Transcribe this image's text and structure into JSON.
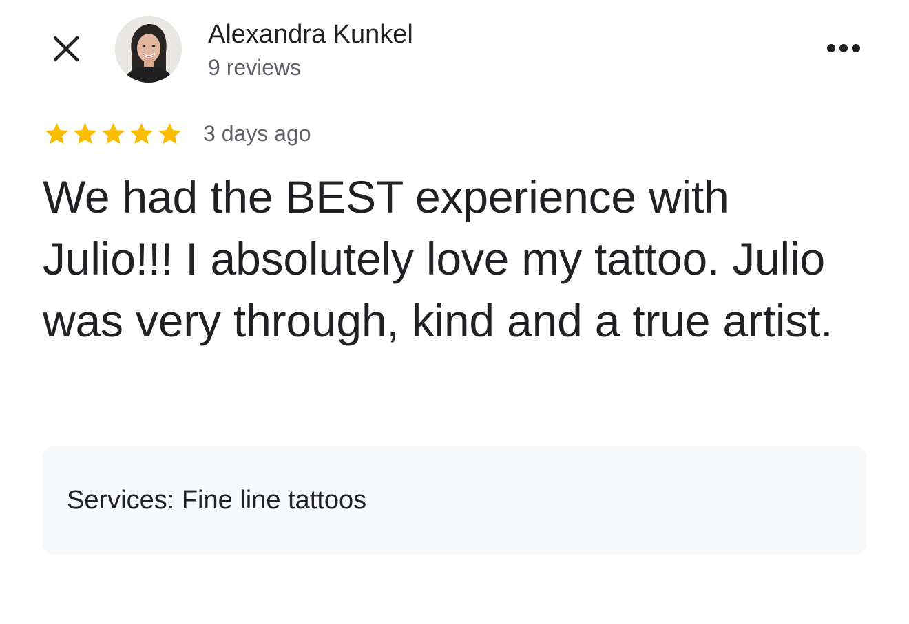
{
  "header": {
    "close_icon": "close-icon",
    "reviewer_name": "Alexandra Kunkel",
    "review_count": "9 reviews",
    "more_icon": "more-horizontal-icon"
  },
  "review": {
    "rating": 5,
    "rating_max": 5,
    "star_color": "#fbbc04",
    "time_ago": "3 days ago",
    "text": "We had the BEST experience with Julio!!! I absolutely love my tattoo. Julio was very through, kind and a true artist."
  },
  "services": {
    "label": "Services:",
    "value": "Fine line tattoos"
  }
}
